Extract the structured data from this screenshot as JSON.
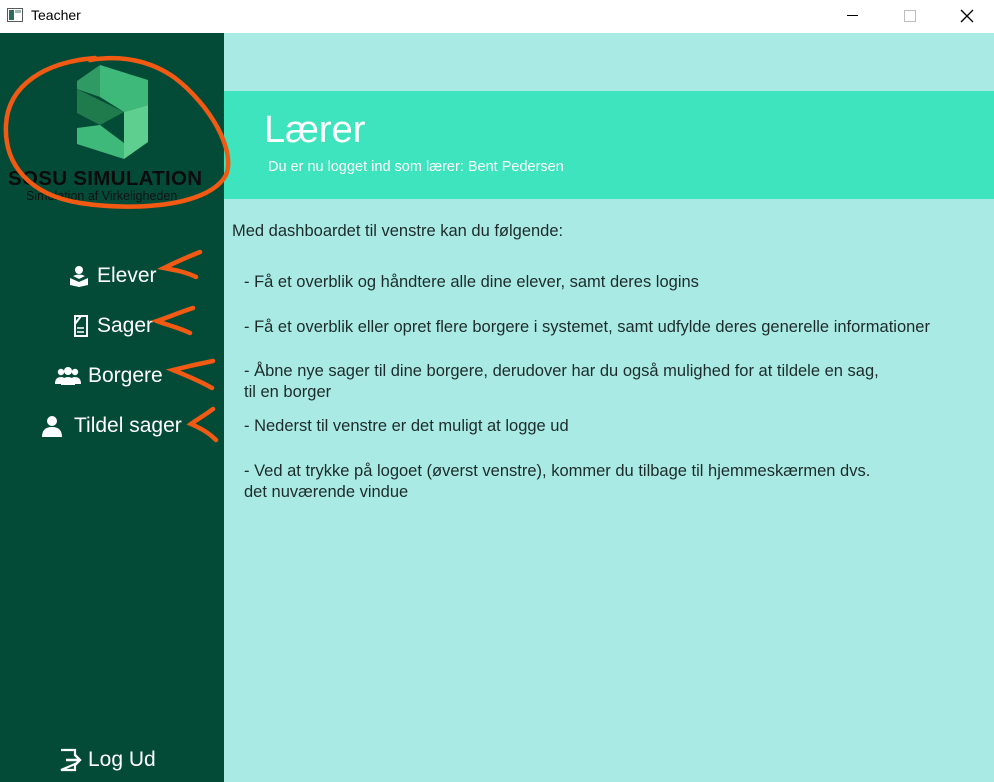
{
  "window": {
    "title": "Teacher",
    "controls": [
      "minimize",
      "maximize",
      "close"
    ]
  },
  "sidebar": {
    "logo": {
      "title": "SOSU SIMULATION",
      "subtitle": "Simulation af Virkeligheden"
    },
    "items": [
      {
        "label": "Elever",
        "icon": "student-reading-icon"
      },
      {
        "label": "Sager",
        "icon": "document-icon"
      },
      {
        "label": "Borgere",
        "icon": "group-icon"
      },
      {
        "label": "Tildel sager",
        "icon": "user-icon"
      }
    ],
    "logout": {
      "label": "Log Ud",
      "icon": "logout-icon"
    }
  },
  "header": {
    "title": "Lærer",
    "subtitle": "Du er nu logget ind som lærer: Bent Pedersen"
  },
  "main": {
    "intro": "Med dashboardet til venstre kan du følgende:",
    "bullets": [
      "- Få et overblik og håndtere alle dine elever, samt deres logins",
      "- Få et overblik eller opret flere borgere i systemet, samt udfylde deres generelle informationer",
      "- Åbne nye sager til dine borgere, derudover har du også mulighed for at tildele en sag,\n  til en borger",
      "- Nederst til venstre er det muligt at logge ud",
      "- Ved at trykke på logoet (øverst venstre), kommer du tilbage til hjemmeskærmen dvs.\n  det nuværende vindue"
    ]
  },
  "colors": {
    "sidebar": "#044b37",
    "main_bg": "#a9ebe4",
    "banner": "#3ee4be",
    "annotation": "#f25a13"
  }
}
